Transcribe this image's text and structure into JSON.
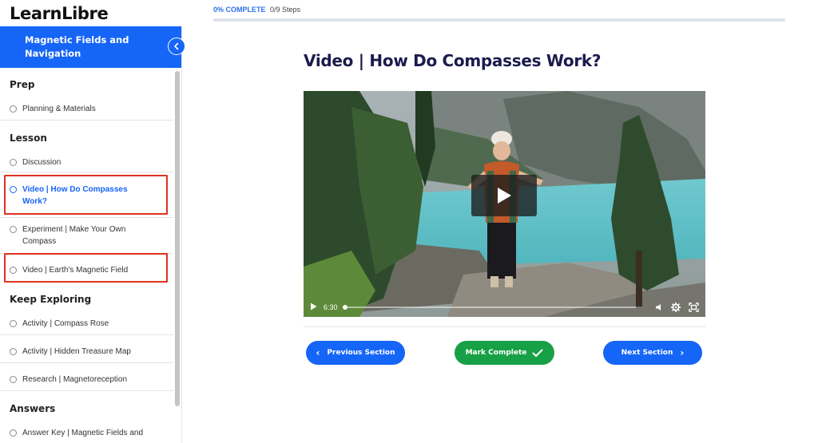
{
  "header": {
    "logo": "LearnLibre",
    "progress_label": "0% COMPLETE",
    "progress_steps": "0/9 Steps",
    "progress_value": 0
  },
  "sidebar": {
    "title": "Magnetic Fields and Navigation",
    "sections": [
      {
        "title": "Prep",
        "items": [
          "Planning & Materials"
        ]
      },
      {
        "title": "Lesson",
        "items": [
          "Discussion",
          "Video | How Do Compasses Work?",
          "Experiment | Make Your Own Compass",
          "Video | Earth's Magnetic Field"
        ]
      },
      {
        "title": "Keep Exploring",
        "items": [
          "Activity | Compass Rose",
          "Activity | Hidden Treasure Map",
          "Research | Magnetoreception"
        ]
      },
      {
        "title": "Answers",
        "items": [
          "Answer Key | Magnetic Fields and"
        ]
      }
    ],
    "active_item": "Video | How Do Compasses Work?"
  },
  "main": {
    "title": "Video | How Do Compasses Work?",
    "video": {
      "time": "6:30",
      "played_fraction": 0
    },
    "buttons": {
      "previous": "Previous Section",
      "complete": "Mark Complete",
      "next": "Next Section"
    }
  },
  "colors": {
    "primary": "#1565f7",
    "success": "#17a046",
    "title": "#1b1b4d",
    "highlight": "#e0321f"
  }
}
